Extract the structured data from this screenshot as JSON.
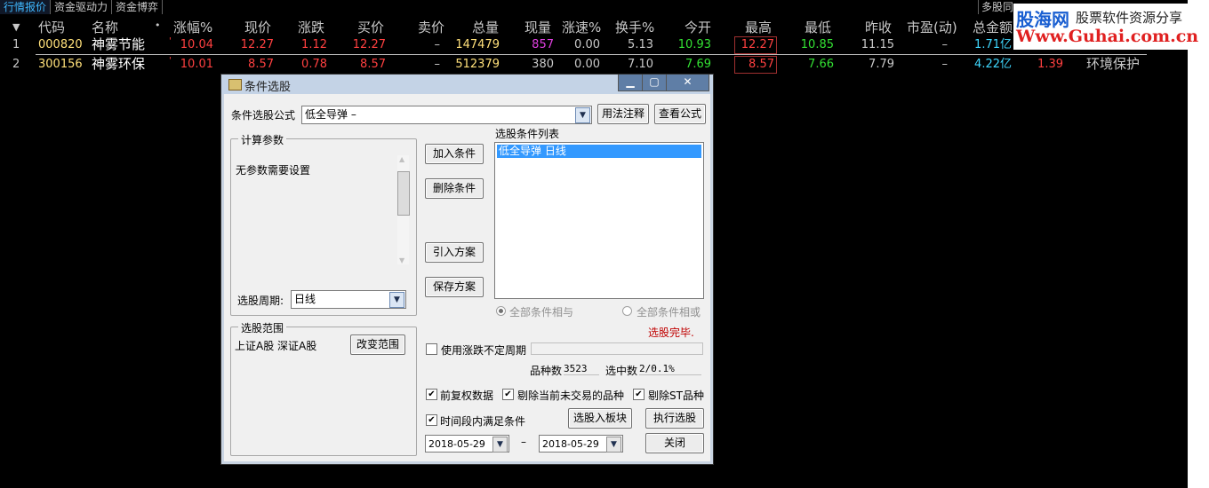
{
  "tabs": [
    {
      "label": "行情报价",
      "active": true
    },
    {
      "label": "资金驱动力",
      "active": false
    },
    {
      "label": "资金博弈",
      "active": false
    }
  ],
  "right_tab": "多股同",
  "watermark": {
    "brand": "股海网",
    "tagline": "股票软件资源分享",
    "url": "Www.Guhai.com.cn"
  },
  "table": {
    "headers": [
      "代码",
      "名称",
      "涨幅%",
      "现价",
      "涨跌",
      "买价",
      "卖价",
      "总量",
      "现量",
      "涨速%",
      "换手%",
      "今开",
      "最高",
      "最低",
      "昨收",
      "市盈(动)",
      "总金额"
    ],
    "rows": [
      {
        "idx": "1",
        "code": "000820",
        "name": "神雾节能",
        "pct": "10.04",
        "price": "12.27",
        "chg": "1.12",
        "bid": "12.27",
        "ask": "–",
        "vol": "147479",
        "cur": "857",
        "speed": "0.00",
        "turnover": "5.13",
        "open": "10.93",
        "high": "12.27",
        "low": "10.85",
        "prev": "11.15",
        "pe": "–",
        "amount": "1.71亿",
        "extra": "",
        "industry": ""
      },
      {
        "idx": "2",
        "code": "300156",
        "name": "神雾环保",
        "pct": "10.01",
        "price": "8.57",
        "chg": "0.78",
        "bid": "8.57",
        "ask": "–",
        "vol": "512379",
        "cur": "380",
        "speed": "0.00",
        "turnover": "7.10",
        "open": "7.69",
        "high": "8.57",
        "low": "7.66",
        "prev": "7.79",
        "pe": "–",
        "amount": "4.22亿",
        "extra": "1.39",
        "industry": "环境保护"
      }
    ]
  },
  "dialog": {
    "title": "条件选股",
    "formula_label": "条件选股公式",
    "formula_value": "低全导弹        –",
    "btn_usage": "用法注释",
    "btn_view": "查看公式",
    "params_group": "计算参数",
    "params_text": "无参数需要设置",
    "period_label": "选股周期:",
    "period_value": "日线",
    "btn_add": "加入条件",
    "btn_delete": "删除条件",
    "btn_import": "引入方案",
    "btn_save": "保存方案",
    "cond_list_label": "选股条件列表",
    "cond_items": [
      "低全导弹   日线"
    ],
    "radio_and": "全部条件相与",
    "radio_or": "全部条件相或",
    "status": "选股完毕.",
    "range_group": "选股范围",
    "range_text": "上证A股 深证A股",
    "btn_change_range": "改变范围",
    "chk_uncertain": "使用涨跌不定周期",
    "count_label": "品种数",
    "count_value": "3523",
    "selected_label": "选中数",
    "selected_value": "2/0.1%",
    "chk_fq": "前复权数据",
    "chk_exclude_nontrade": "剔除当前未交易的品种",
    "chk_exclude_st": "剔除ST品种",
    "chk_period": "时间段内满足条件",
    "btn_to_block": "选股入板块",
    "btn_execute": "执行选股",
    "date_from": "2018-05-29",
    "date_to": "2018-05-29",
    "date_sep": "–",
    "btn_close": "关闭"
  }
}
